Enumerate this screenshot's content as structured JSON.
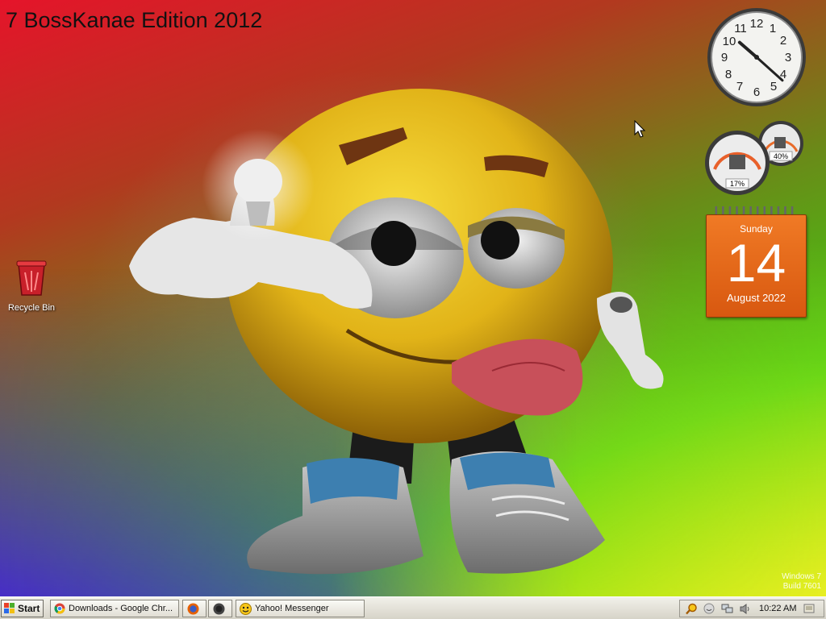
{
  "desktop": {
    "edition_title": "7 BossKanae Edition 2012",
    "icons": [
      {
        "label": "Recycle Bin",
        "icon": "recycle-bin-icon"
      }
    ],
    "watermark_line1": "Windows 7",
    "watermark_line2": "Build 7601"
  },
  "gadgets": {
    "clock": {
      "hour": 10,
      "minute": 22
    },
    "meters": {
      "cpu_label": "17%",
      "memory_label": "40%",
      "cpu_percent": 17,
      "memory_percent": 40
    },
    "calendar": {
      "weekday": "Sunday",
      "day": "14",
      "month_year": "August 2022"
    }
  },
  "taskbar": {
    "start_label": "Start",
    "tasks": [
      {
        "label": "Downloads - Google Chr...",
        "icon": "chrome-icon"
      },
      {
        "label": "",
        "icon": "firefox-icon"
      },
      {
        "label": "",
        "icon": "app-circle-icon"
      },
      {
        "label": "Yahoo! Messenger",
        "icon": "yahoo-messenger-icon"
      }
    ],
    "tray_icons": [
      "search-icon",
      "messenger-tray-icon",
      "network-icon",
      "volume-icon"
    ],
    "clock": "10:22 AM"
  }
}
